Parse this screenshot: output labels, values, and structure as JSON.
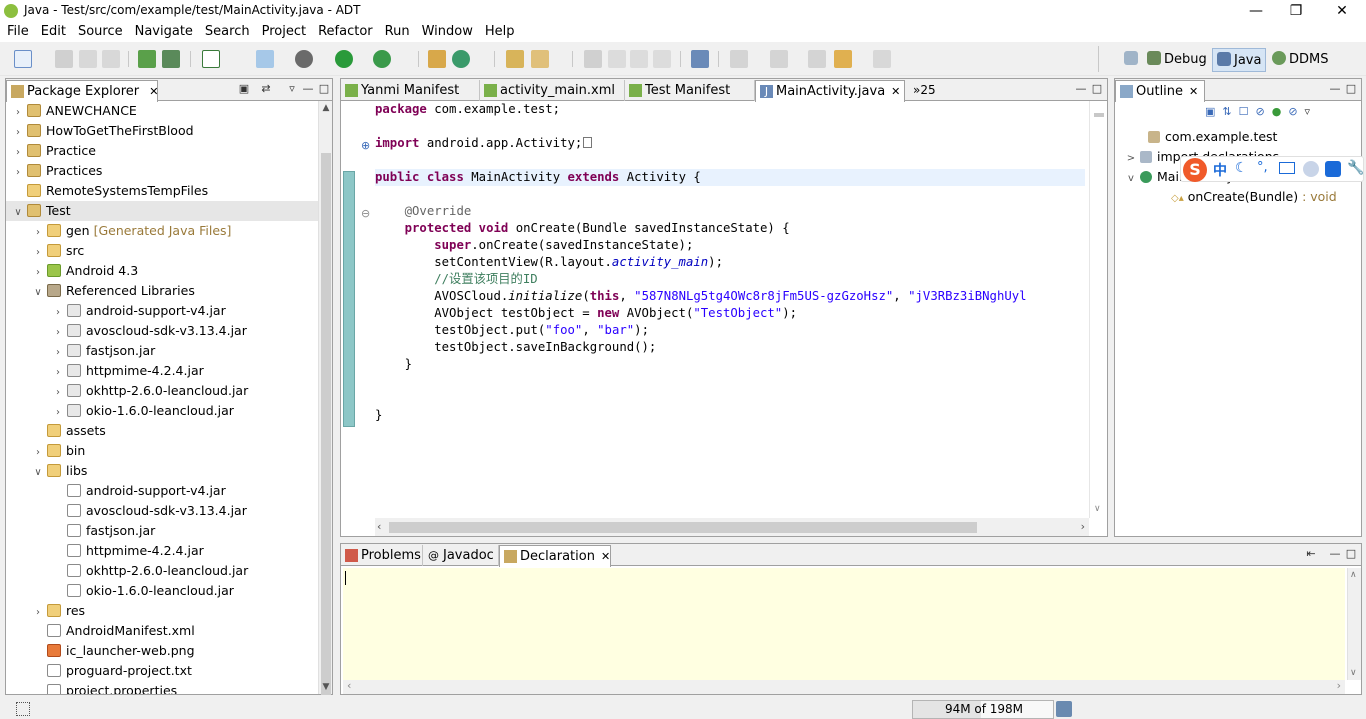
{
  "window": {
    "title": "Java - Test/src/com/example/test/MainActivity.java - ADT"
  },
  "menu": [
    "File",
    "Edit",
    "Source",
    "Navigate",
    "Search",
    "Project",
    "Refactor",
    "Run",
    "Window",
    "Help"
  ],
  "perspectives": [
    {
      "label": "Debug",
      "active": false
    },
    {
      "label": "Java",
      "active": true
    },
    {
      "label": "DDMS",
      "active": false
    }
  ],
  "package_explorer": {
    "title": "Package Explorer",
    "items": [
      {
        "label": "ANEWCHANCE",
        "indent": 0,
        "arrow": ">",
        "icon": "proj"
      },
      {
        "label": "HowToGetTheFirstBlood",
        "indent": 0,
        "arrow": ">",
        "icon": "proj"
      },
      {
        "label": "Practice",
        "indent": 0,
        "arrow": ">",
        "icon": "proj"
      },
      {
        "label": "Practices",
        "indent": 0,
        "arrow": ">",
        "icon": "proj"
      },
      {
        "label": "RemoteSystemsTempFiles",
        "indent": 0,
        "arrow": "",
        "icon": "folder"
      },
      {
        "label": "Test",
        "indent": 0,
        "arrow": "v",
        "icon": "proj",
        "selected": true
      },
      {
        "label": "gen",
        "decoration": "[Generated Java Files]",
        "indent": 1,
        "arrow": ">",
        "icon": "folder"
      },
      {
        "label": "src",
        "indent": 1,
        "arrow": ">",
        "icon": "folder"
      },
      {
        "label": "Android 4.3",
        "indent": 1,
        "arrow": ">",
        "icon": "android"
      },
      {
        "label": "Referenced Libraries",
        "indent": 1,
        "arrow": "v",
        "icon": "lib"
      },
      {
        "label": "android-support-v4.jar",
        "indent": 2,
        "arrow": ">",
        "icon": "jar"
      },
      {
        "label": "avoscloud-sdk-v3.13.4.jar",
        "indent": 2,
        "arrow": ">",
        "icon": "jar"
      },
      {
        "label": "fastjson.jar",
        "indent": 2,
        "arrow": ">",
        "icon": "jar"
      },
      {
        "label": "httpmime-4.2.4.jar",
        "indent": 2,
        "arrow": ">",
        "icon": "jar"
      },
      {
        "label": "okhttp-2.6.0-leancloud.jar",
        "indent": 2,
        "arrow": ">",
        "icon": "jar"
      },
      {
        "label": "okio-1.6.0-leancloud.jar",
        "indent": 2,
        "arrow": ">",
        "icon": "jar"
      },
      {
        "label": "assets",
        "indent": 1,
        "arrow": "",
        "icon": "folder"
      },
      {
        "label": "bin",
        "indent": 1,
        "arrow": ">",
        "icon": "folder"
      },
      {
        "label": "libs",
        "indent": 1,
        "arrow": "v",
        "icon": "folder"
      },
      {
        "label": "android-support-v4.jar",
        "indent": 2,
        "arrow": "",
        "icon": "file"
      },
      {
        "label": "avoscloud-sdk-v3.13.4.jar",
        "indent": 2,
        "arrow": "",
        "icon": "file"
      },
      {
        "label": "fastjson.jar",
        "indent": 2,
        "arrow": "",
        "icon": "file"
      },
      {
        "label": "httpmime-4.2.4.jar",
        "indent": 2,
        "arrow": "",
        "icon": "file"
      },
      {
        "label": "okhttp-2.6.0-leancloud.jar",
        "indent": 2,
        "arrow": "",
        "icon": "file"
      },
      {
        "label": "okio-1.6.0-leancloud.jar",
        "indent": 2,
        "arrow": "",
        "icon": "file"
      },
      {
        "label": "res",
        "indent": 1,
        "arrow": ">",
        "icon": "folder"
      },
      {
        "label": "AndroidManifest.xml",
        "indent": 1,
        "arrow": "",
        "icon": "file"
      },
      {
        "label": "ic_launcher-web.png",
        "indent": 1,
        "arrow": "",
        "icon": "png"
      },
      {
        "label": "proguard-project.txt",
        "indent": 1,
        "arrow": "",
        "icon": "file"
      },
      {
        "label": "project.properties",
        "indent": 1,
        "arrow": "",
        "icon": "file"
      }
    ]
  },
  "editor": {
    "tabs": [
      {
        "label": "Yanmi Manifest",
        "active": false
      },
      {
        "label": "activity_main.xml",
        "active": false
      },
      {
        "label": "Test Manifest",
        "active": false
      },
      {
        "label": "MainActivity.java",
        "active": true
      }
    ],
    "overflow": "»25",
    "lines": {
      "l1": [
        "package",
        " com.example.test;"
      ],
      "l2": [
        "import",
        " android.app.Activity;"
      ],
      "l3": [
        "public",
        "class",
        " MainActivity ",
        "extends",
        " Activity {"
      ],
      "l4": "@Override",
      "l5": [
        "protected",
        "void",
        " onCreate(Bundle savedInstanceState) {"
      ],
      "l6": [
        "super",
        ".onCreate(savedInstanceState);"
      ],
      "l7": [
        "setContentView(R.layout.",
        "activity_main",
        ");"
      ],
      "l8": "//设置该项目的ID",
      "l9": [
        "AVOSCloud.",
        "initialize",
        "(",
        "this",
        ", ",
        "\"587N8NLg5tg4OWc8r8jFm5US-gzGzoHsz\"",
        ", ",
        "\"jV3RBz3iBNghUyl"
      ],
      "l10": [
        "AVObject testObject = ",
        "new",
        " AVObject(",
        "\"TestObject\"",
        ");"
      ],
      "l11": [
        "testObject.put(",
        "\"foo\"",
        ", ",
        "\"bar\"",
        ");"
      ],
      "l12": "testObject.saveInBackground();",
      "l13": "}",
      "l14": "}"
    }
  },
  "outline": {
    "title": "Outline",
    "items": [
      {
        "label": "com.example.test"
      },
      {
        "label": "import declarations"
      },
      {
        "label": "MainActivity"
      },
      {
        "label": "onCreate(Bundle)",
        "type": " : void"
      }
    ]
  },
  "ime_toolbar": {
    "label": "中"
  },
  "bottom": {
    "tabs": [
      {
        "label": "Problems",
        "active": false
      },
      {
        "label": "Javadoc",
        "active": false
      },
      {
        "label": "Declaration",
        "active": true
      }
    ]
  },
  "status": {
    "memory": "94M of 198M"
  }
}
